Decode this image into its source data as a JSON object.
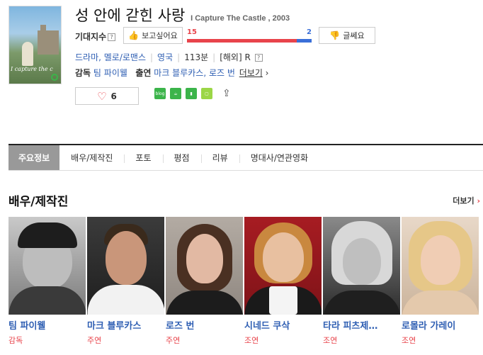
{
  "movie": {
    "title_kr": "성 안에 갇힌 사랑",
    "title_en": "I Capture The Castle , 2003",
    "poster_text": "I capture the c"
  },
  "expect": {
    "label": "기대지수",
    "help": "?",
    "want_label": "보고싶어요",
    "meh_label": "글쎄요",
    "want_count": "15",
    "meh_count": "2",
    "want_fraction": 0.88
  },
  "meta": {
    "genre": "드라마, 멜로/로맨스",
    "country": "영국",
    "runtime": "113분",
    "release": "[해외]",
    "rating": "R",
    "help": "?"
  },
  "credits": {
    "director_label": "감독",
    "director": "팀 파이웰",
    "cast_label": "출연",
    "cast": "마크 블루카스, 로즈 번",
    "more": "더보기"
  },
  "like": {
    "count": "6"
  },
  "share": {
    "blog": "blog"
  },
  "tabs": [
    {
      "label": "주요정보"
    },
    {
      "label": "배우/제작진"
    },
    {
      "label": "포토"
    },
    {
      "label": "평점"
    },
    {
      "label": "리뷰"
    },
    {
      "label": "명대사/연관영화"
    }
  ],
  "section": {
    "title": "배우/제작진",
    "more": "더보기"
  },
  "people": [
    {
      "name": "팀 파이웰",
      "role": "감독"
    },
    {
      "name": "마크 블루카스",
      "role": "주연"
    },
    {
      "name": "로즈 번",
      "role": "주연"
    },
    {
      "name": "시네드 쿠삭",
      "role": "조연"
    },
    {
      "name": "타라 피츠제…",
      "role": "조연"
    },
    {
      "name": "로몰라 가레이",
      "role": "조연"
    }
  ]
}
